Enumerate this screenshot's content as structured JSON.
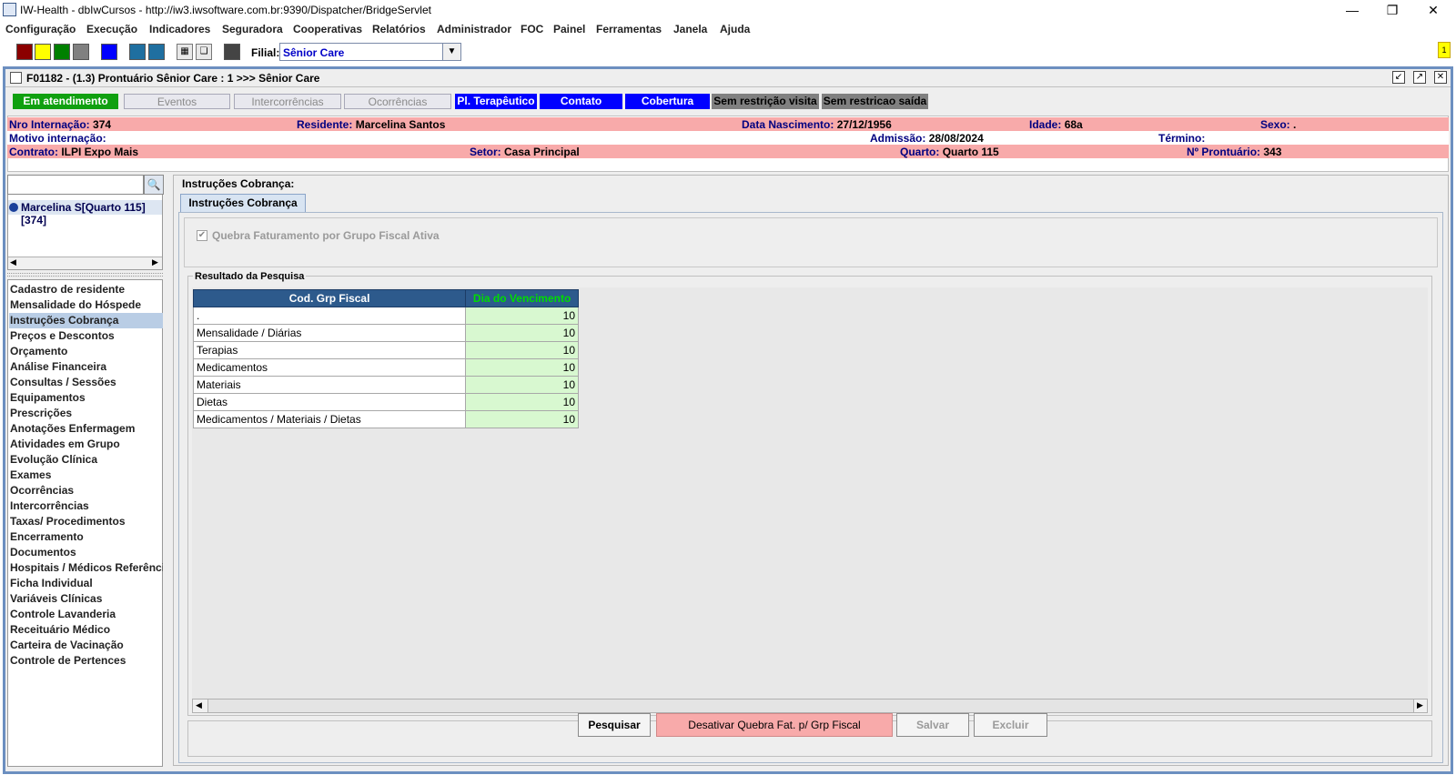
{
  "window": {
    "title": "IW-Health - dbIwCursos - http://iw3.iwsoftware.com.br:9390/Dispatcher/BridgeServlet"
  },
  "menu": [
    "Configuração",
    "Execução",
    "Indicadores",
    "Seguradora",
    "Cooperativas",
    "Relatórios",
    "Administrador",
    "FOC",
    "Painel",
    "Ferramentas",
    "Janela",
    "Ajuda"
  ],
  "toolbar": {
    "filial_label": "Filial:",
    "filial_value": "Sênior Care",
    "notification_badge": "1",
    "swatches": [
      "#8b0000",
      "#ffff00",
      "#008000",
      "#808080",
      "#0000ff",
      "#1f6fa0",
      "#1f6fa0",
      "#444444"
    ]
  },
  "frame": {
    "title": "F01182 - (1.3) Prontuário Sênior Care : 1 >>> Sênior Care"
  },
  "status_tabs": [
    {
      "label": "Em atendimento",
      "bg": "#10a010",
      "fg": "#ffffff"
    },
    {
      "label": "Eventos",
      "bg": "#e8e8ee",
      "fg": "#8a8a8a"
    },
    {
      "label": "Intercorrências",
      "bg": "#e8e8ee",
      "fg": "#8a8a8a"
    },
    {
      "label": "Ocorrências",
      "bg": "#e8e8ee",
      "fg": "#8a8a8a"
    },
    {
      "label": "Pl. Terapêutico",
      "bg": "#0000ff",
      "fg": "#ffffff"
    },
    {
      "label": "Contato",
      "bg": "#0000ff",
      "fg": "#ffffff"
    },
    {
      "label": "Cobertura",
      "bg": "#0000ff",
      "fg": "#ffffff"
    },
    {
      "label": "Sem restrição visita",
      "bg": "#808080",
      "fg": "#000000"
    },
    {
      "label": "Sem restricao saída",
      "bg": "#808080",
      "fg": "#000000"
    }
  ],
  "patient": {
    "nro_internacao_label": "Nro Internação:",
    "nro_internacao": "374",
    "residente_label": "Residente:",
    "residente": "Marcelina Santos",
    "nascimento_label": "Data Nascimento:",
    "nascimento": "27/12/1956",
    "idade_label": "Idade:",
    "idade": "68a",
    "sexo_label": "Sexo:",
    "sexo": ".",
    "motivo_label": "Motivo internação:",
    "admissao_label": "Admissão:",
    "admissao": "28/08/2024",
    "termino_label": "Término:",
    "contrato_label": "Contrato:",
    "contrato": "ILPI Expo Mais",
    "setor_label": "Setor:",
    "setor": "Casa Principal",
    "quarto_label": "Quarto:",
    "quarto": "Quarto 115",
    "prontuario_label": "Nº Prontuário:",
    "prontuario": "343"
  },
  "sidebar": {
    "search_value": "",
    "patient_item": "Marcelina S[Quarto 115][374]",
    "nav": [
      "Cadastro de residente",
      "Mensalidade do Hóspede",
      "Instruções Cobrança",
      "Preços e Descontos",
      "Orçamento",
      "Análise Financeira",
      "Consultas / Sessões",
      "Equipamentos",
      "Prescrições",
      "Anotações Enfermagem",
      "Atividades em Grupo",
      "Evolução Clínica",
      "Exames",
      "Ocorrências",
      "Intercorrências",
      "Taxas/ Procedimentos",
      "Encerramento",
      "Documentos",
      "Hospitais / Médicos Referência",
      "Ficha Individual",
      "Variáveis Clínicas",
      "Controle Lavanderia",
      "Receituário Médico",
      "Carteira de Vacinação",
      "Controle de Pertences"
    ],
    "selected": "Instruções Cobrança"
  },
  "content": {
    "group_title": "Instruções Cobrança:",
    "tab": "Instruções Cobrança",
    "checkbox_label": "Quebra Faturamento por Grupo Fiscal Ativa",
    "checkbox_checked": true,
    "results_title": "Resultado da Pesquisa",
    "columns": [
      "Cod. Grp Fiscal",
      "Dia do Vencimento"
    ],
    "rows": [
      [
        ".",
        "10"
      ],
      [
        "Mensalidade / Diárias",
        "10"
      ],
      [
        "Terapias",
        "10"
      ],
      [
        "Medicamentos",
        "10"
      ],
      [
        "Materiais",
        "10"
      ],
      [
        "Dietas",
        "10"
      ],
      [
        "Medicamentos / Materiais / Dietas",
        "10"
      ]
    ]
  },
  "buttons": {
    "pesquisar": "Pesquisar",
    "desativar": "Desativar Quebra Fat. p/ Grp Fiscal",
    "salvar": "Salvar",
    "excluir": "Excluir"
  }
}
